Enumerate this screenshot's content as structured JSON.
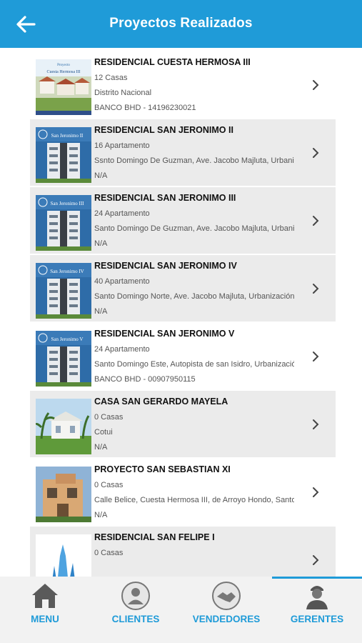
{
  "header": {
    "title": "Proyectos Realizados",
    "back_icon": "arrow-left-icon"
  },
  "colors": {
    "primary": "#1f9bd8",
    "row_gray": "#ebebeb"
  },
  "projects": [
    {
      "name": "RESIDENCIAL CUESTA HERMOSA III",
      "units": "12 Casas",
      "location": "Distrito Nacional",
      "bank": "BANCO BHD - 14196230021",
      "thumb_text": "Cuesta Hermosa III"
    },
    {
      "name": "RESIDENCIAL SAN JERONIMO II",
      "units": "16 Apartamento",
      "location": "Ssnto Domingo De Guzman, Ave. Jacobo Majluta, Urbanización",
      "bank": "N/A",
      "thumb_text": "San Jeronimo II"
    },
    {
      "name": "RESIDENCIAL SAN JERONIMO III",
      "units": "24 Apartamento",
      "location": "Santo Domingo De Guzman, Ave. Jacobo Majluta, Urbanización",
      "bank": "N/A",
      "thumb_text": "San Jeronimo III"
    },
    {
      "name": "RESIDENCIAL SAN JERONIMO IV",
      "units": "40 Apartamento",
      "location": "Santo Domingo Norte, Ave. Jacobo Majluta, Urbanización",
      "bank": "N/A",
      "thumb_text": "San Jeronimo IV"
    },
    {
      "name": "RESIDENCIAL SAN JERONIMO V",
      "units": "24 Apartamento",
      "location": "Santo Domingo Este, Autopista de san Isidro, Urbanización",
      "bank": "BANCO BHD - 00907950115",
      "thumb_text": "San Jeronimo V"
    },
    {
      "name": "CASA SAN GERARDO MAYELA",
      "units": "0 Casas",
      "location": "Cotui",
      "bank": "N/A",
      "thumb_text": ""
    },
    {
      "name": "PROYECTO SAN SEBASTIAN XI",
      "units": "0 Casas",
      "location": "Calle Belice, Cuesta Hermosa III, de Arroyo Hondo, Santo Domingo",
      "bank": "N/A",
      "thumb_text": ""
    },
    {
      "name": "RESIDENCIAL SAN FELIPE I",
      "units": "0 Casas",
      "location": "",
      "bank": "",
      "thumb_text": ""
    }
  ],
  "tabs": [
    {
      "label": "MENU",
      "icon": "home-icon"
    },
    {
      "label": "CLIENTES",
      "icon": "client-icon"
    },
    {
      "label": "VENDEDORES",
      "icon": "handshake-icon"
    },
    {
      "label": "GERENTES",
      "icon": "manager-icon"
    }
  ]
}
